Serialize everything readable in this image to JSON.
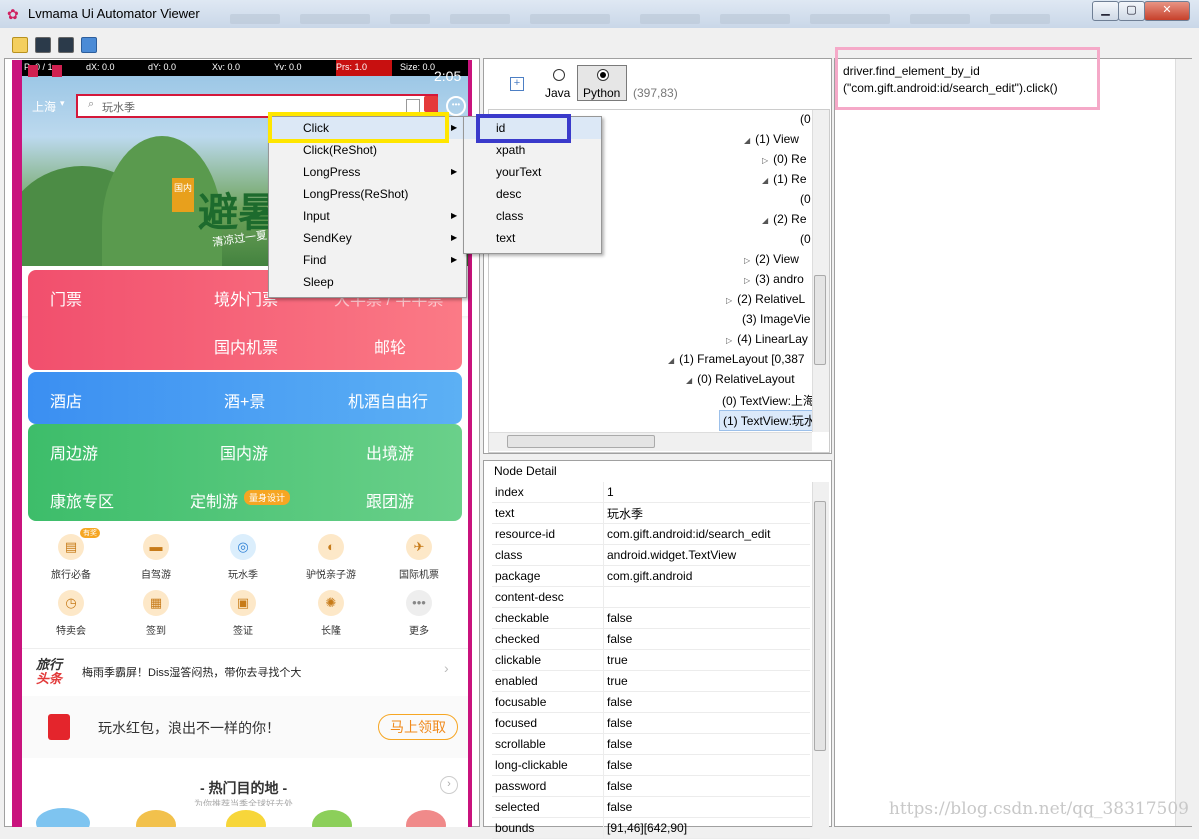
{
  "window": {
    "title": "Lvmama Ui Automator Viewer",
    "min": "▁",
    "max": "▢",
    "close": "✕"
  },
  "toolbar": {
    "icons": [
      "open-icon",
      "screenshot-icon",
      "screenshot-compressed-icon",
      "save-icon"
    ]
  },
  "phone": {
    "status": {
      "p": "P: 0 / 1",
      "dx": "dX: 0.0",
      "dy": "dY: 0.0",
      "xv": "Xv: 0.0",
      "yv": "Yv: 0.0",
      "prs": "Prs: 1.0",
      "size": "Size: 0.0",
      "time": "2:05"
    },
    "city": "上海",
    "search_text": "玩水季",
    "banner_title": "避暑",
    "banner_tag": "国内",
    "banner_sub": "清凉过一夏，最低",
    "grid": {
      "row1": [
        "门票",
        "境外门票",
        "大半票 / 半半票"
      ],
      "row2": [
        "国内机票",
        "邮轮"
      ],
      "row3": [
        "酒店",
        "酒+景",
        "机酒自由行"
      ],
      "row4": [
        "周边游",
        "国内游",
        "出境游"
      ],
      "row5": [
        "康旅专区",
        "定制游",
        "跟团游"
      ],
      "badge": "量身设计"
    },
    "icons1": [
      "旅行必备",
      "自驾游",
      "玩水季",
      "驴悦亲子游",
      "国际机票"
    ],
    "icons2": [
      "特卖会",
      "签到",
      "签证",
      "长隆",
      "更多"
    ],
    "icon_badge": "有奖",
    "news_logo1": "旅行",
    "news_logo2": "头条",
    "news_text": "梅雨季霸屏！Diss湿答闷热，带你去寻找个大",
    "redpacket_text": "玩水红包，浪出不一样的你！",
    "redpacket_btn": "马上领取",
    "hot_title": "- 热门目的地 -",
    "hot_sub": "为你推荐当季全球好去处"
  },
  "lang": {
    "java": "Java",
    "python": "Python",
    "coords": "(397,83)"
  },
  "tree": [
    "(0",
    "(1) View",
    "(0) Re",
    "(1) Re",
    "(0",
    "(2) Re",
    "(0",
    "(2) View",
    "(3) andro",
    "(2) RelativeL",
    "(3) ImageVie",
    "(4) LinearLay",
    "(1) FrameLayout [0,387",
    "(0) RelativeLayout",
    "(0) TextView:上海",
    "(1) TextView:玩水"
  ],
  "menu": {
    "items": [
      "Click",
      "Click(ReShot)",
      "LongPress",
      "LongPress(ReShot)",
      "Input",
      "SendKey",
      "Find",
      "Sleep"
    ],
    "submenu": [
      "id",
      "xpath",
      "yourText",
      "desc",
      "class",
      "text"
    ]
  },
  "node_detail": {
    "title": "Node Detail",
    "rows": [
      [
        "index",
        "1"
      ],
      [
        "text",
        "玩水季"
      ],
      [
        "resource-id",
        "com.gift.android:id/search_edit"
      ],
      [
        "class",
        "android.widget.TextView"
      ],
      [
        "package",
        "com.gift.android"
      ],
      [
        "content-desc",
        ""
      ],
      [
        "checkable",
        "false"
      ],
      [
        "checked",
        "false"
      ],
      [
        "clickable",
        "true"
      ],
      [
        "enabled",
        "true"
      ],
      [
        "focusable",
        "false"
      ],
      [
        "focused",
        "false"
      ],
      [
        "scrollable",
        "false"
      ],
      [
        "long-clickable",
        "false"
      ],
      [
        "password",
        "false"
      ],
      [
        "selected",
        "false"
      ],
      [
        "bounds",
        "[91,46][642,90]"
      ]
    ]
  },
  "code": {
    "line1": "driver.find_element_by_id",
    "line2": "(\"com.gift.android:id/search_edit\").click()"
  },
  "watermark": "https://blog.csdn.net/qq_38317509"
}
